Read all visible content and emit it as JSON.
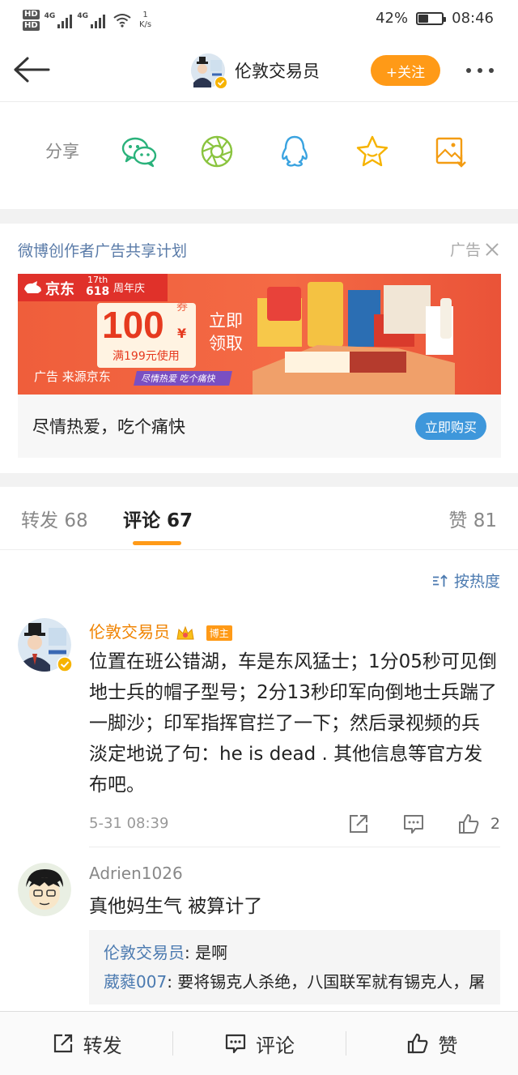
{
  "status": {
    "hd1": "HD",
    "hd2": "HD",
    "net1": "4G",
    "net2": "4G",
    "speed_value": "1",
    "speed_unit": "K/s",
    "battery": "42%",
    "battery_level": 0.42,
    "time": "08:46"
  },
  "nav": {
    "title": "伦敦交易员",
    "follow_label": "+关注"
  },
  "share": {
    "label": "分享",
    "targets": [
      "wechat-icon",
      "moments-icon",
      "qq-icon",
      "favorite-icon",
      "save-image-icon"
    ]
  },
  "ad": {
    "title": "微博创作者广告共享计划",
    "tag": "广告",
    "banner": {
      "brand": "京东",
      "anniv_top": "17th",
      "anniv_bottom": "618",
      "anniv_label": "周年庆",
      "coupon_small": "券",
      "coupon_amount": "100",
      "coupon_currency": "¥",
      "coupon_cond": "满199元使用",
      "claim_line1": "立即",
      "claim_line2": "领取",
      "source": "广告 来源京东",
      "slogan_pill": "尽情热爱 吃个痛快"
    },
    "slogan": "尽情热爱，吃个痛快",
    "buy_label": "立即购买"
  },
  "tabs": [
    {
      "label": "转发",
      "count": "68"
    },
    {
      "label": "评论",
      "count": "67"
    },
    {
      "label": "赞",
      "count": "81"
    }
  ],
  "sort_label": "按热度",
  "comments": [
    {
      "user": "伦敦交易员",
      "badge": "博主",
      "text": "位置在班公错湖，车是东风猛士；1分05秒可见倒地士兵的帽子型号；2分13秒印军向倒地士兵踹了一脚沙；印军指挥官拦了一下；然后录视频的兵淡定地说了句：he is dead . 其他信息等官方发布吧。",
      "time": "5-31 08:39",
      "likes": "2"
    },
    {
      "user": "Adrien1026",
      "text": "真他妈生气 被算计了",
      "replies": [
        {
          "user": "伦敦交易员",
          "text": "是啊"
        },
        {
          "user": "葳蕤007",
          "text": "要将锡克人杀绝，八国联军就有锡克人，屠杀藏族人也是锡克人"
        }
      ]
    }
  ],
  "bottom": {
    "repost": "转发",
    "comment": "评论",
    "like": "赞"
  },
  "colors": {
    "accent": "#ff9a17",
    "link": "#4b7ab0",
    "button_blue": "#3e97db",
    "ad_red": "#ef5e3b"
  }
}
